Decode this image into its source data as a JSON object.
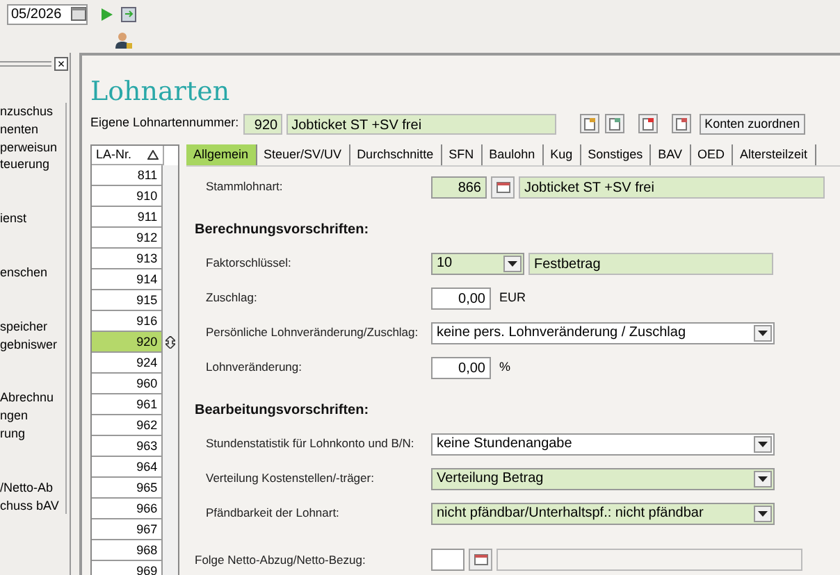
{
  "toolbar": {
    "period": "05/2026"
  },
  "sidebar": {
    "close": "×",
    "groups": [
      [
        "nzuschus",
        "nenten",
        "perweisun",
        "teuerung"
      ],
      [
        "ienst"
      ],
      [
        "enschen"
      ],
      [
        "speicher",
        "gebniswer"
      ],
      [
        "Abrechnu",
        "ngen",
        "rung"
      ],
      [
        "/Netto-Ab",
        "chuss bAV"
      ]
    ]
  },
  "title": "Lohnarten",
  "own_number": {
    "label": "Eigene Lohnartennummer:",
    "code": "920",
    "name": "Jobticket ST +SV frei"
  },
  "actions": [
    {
      "kind": "new"
    },
    {
      "kind": "copy"
    },
    {
      "kind": "delete"
    },
    {
      "kind": "lookup"
    },
    {
      "kind": "text",
      "label": "Konten zuordnen"
    }
  ],
  "list": {
    "column": "LA-Nr.",
    "rows": [
      {
        "number": "811",
        "selected": false
      },
      {
        "number": "910",
        "selected": false
      },
      {
        "number": "911",
        "selected": false
      },
      {
        "number": "912",
        "selected": false
      },
      {
        "number": "913",
        "selected": false
      },
      {
        "number": "914",
        "selected": false
      },
      {
        "number": "915",
        "selected": false
      },
      {
        "number": "916",
        "selected": false
      },
      {
        "number": "920",
        "selected": true
      },
      {
        "number": "924",
        "selected": false
      },
      {
        "number": "960",
        "selected": false
      },
      {
        "number": "961",
        "selected": false
      },
      {
        "number": "962",
        "selected": false
      },
      {
        "number": "963",
        "selected": false
      },
      {
        "number": "964",
        "selected": false
      },
      {
        "number": "965",
        "selected": false
      },
      {
        "number": "966",
        "selected": false
      },
      {
        "number": "967",
        "selected": false
      },
      {
        "number": "968",
        "selected": false
      },
      {
        "number": "969",
        "selected": false
      }
    ]
  },
  "tabs": [
    {
      "label": "Allgemein",
      "selected": true
    },
    {
      "label": "Steuer/SV/UV",
      "selected": false
    },
    {
      "label": "Durchschnitte",
      "selected": false
    },
    {
      "label": "SFN",
      "selected": false
    },
    {
      "label": "Baulohn",
      "selected": false
    },
    {
      "label": "Kug",
      "selected": false
    },
    {
      "label": "Sonstiges",
      "selected": false
    },
    {
      "label": "BAV",
      "selected": false
    },
    {
      "label": "OED",
      "selected": false
    },
    {
      "label": "Altersteilzeit",
      "selected": false
    }
  ],
  "form": [
    {
      "kind": "lookup",
      "label": "Stammlohnart:",
      "code": "866",
      "name": "Jobticket ST +SV frei",
      "filled": true
    },
    {
      "kind": "heading",
      "label": "Berechnungsvorschriften:"
    },
    {
      "kind": "code_select",
      "label": "Faktorschlüssel:",
      "code": "10",
      "name": "Festbetrag",
      "filled": true
    },
    {
      "kind": "amount",
      "label": "Zuschlag:",
      "value": "0,00",
      "unit": "EUR",
      "filled": false
    },
    {
      "kind": "select",
      "label": "Persönliche Lohnveränderung/Zuschlag:",
      "value": "keine pers. Lohnveränderung / Zuschlag",
      "filled": false
    },
    {
      "kind": "amount",
      "label": "Lohnveränderung:",
      "value": "0,00",
      "unit": "%",
      "filled": false
    },
    {
      "kind": "heading",
      "label": "Bearbeitungsvorschriften:"
    },
    {
      "kind": "select",
      "label": "Stundenstatistik für Lohnkonto und B/N:",
      "value": "keine Stundenangabe",
      "filled": false
    },
    {
      "kind": "select",
      "label": "Verteilung Kostenstellen/-träger:",
      "value": "Verteilung Betrag",
      "filled": true
    },
    {
      "kind": "select",
      "label": "Pfändbarkeit der Lohnart:",
      "value": "nicht pfändbar/Unterhaltspf.: nicht pfändbar",
      "filled": true
    },
    {
      "kind": "standalone_lookup",
      "label": "Folge Netto-Abzug/Netto-Bezug:",
      "filled": false
    }
  ]
}
